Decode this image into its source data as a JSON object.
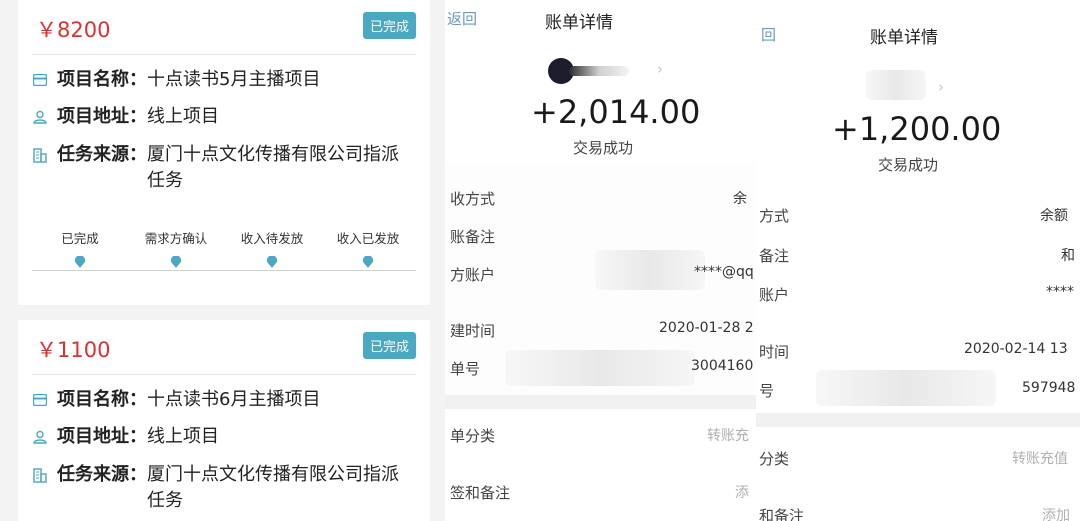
{
  "colors": {
    "price": "#d9322f",
    "badge_bg": "#4aa9c0",
    "accent_icon": "#4aa9c0",
    "step_dot": "#4aa9c0"
  },
  "cards": [
    {
      "price": "￥8200",
      "badge": "已完成",
      "project_name_label": "项目名称：",
      "project_name_value": "十点读书5月主播项目",
      "project_address_label": "项目地址：",
      "project_address_value": "线上项目",
      "task_source_label": "任务来源：",
      "task_source_value": "厦门十点文化传播有限公司指派任务",
      "steps": [
        "已完成",
        "需求方确认",
        "收入待发放",
        "收入已发放"
      ]
    },
    {
      "price": "￥1100",
      "badge": "已完成",
      "project_name_label": "项目名称：",
      "project_name_value": "十点读书6月主播项目",
      "project_address_label": "项目地址：",
      "project_address_value": "线上项目",
      "task_source_label": "任务来源：",
      "task_source_value": "厦门十点文化传播有限公司指派任务"
    }
  ],
  "bill_mid": {
    "back": "返回",
    "title": "账单详情",
    "amount": "+2,014.00",
    "status": "交易成功",
    "rows": [
      {
        "label": "收方式",
        "value": "余"
      },
      {
        "label": "账备注",
        "value": ""
      },
      {
        "label": "方账户",
        "value": "****@qq"
      },
      {
        "label": "建时间",
        "value": "2020-01-28 2"
      },
      {
        "label": "单号",
        "value": "3004160"
      },
      {
        "label": "单分类",
        "value": "转账充"
      },
      {
        "label": "签和备注",
        "value": "添"
      }
    ]
  },
  "bill_right": {
    "back": "回",
    "title": "账单详情",
    "amount": "+1,200.00",
    "status": "交易成功",
    "rows": [
      {
        "label": "方式",
        "value": "余额"
      },
      {
        "label": "备注",
        "value": "和"
      },
      {
        "label": "账户",
        "value": "****"
      },
      {
        "label": "时间",
        "value": "2020-02-14 13"
      },
      {
        "label": "号",
        "value": "597948"
      },
      {
        "label": "分类",
        "value": "转账充值"
      },
      {
        "label": "和备注",
        "value": "添加"
      }
    ]
  },
  "icons": {
    "project_name": "card-icon",
    "project_address": "person-icon",
    "task_source": "building-icon",
    "step_marker": "location-pin-icon",
    "chevron": "chevron-right-icon"
  }
}
